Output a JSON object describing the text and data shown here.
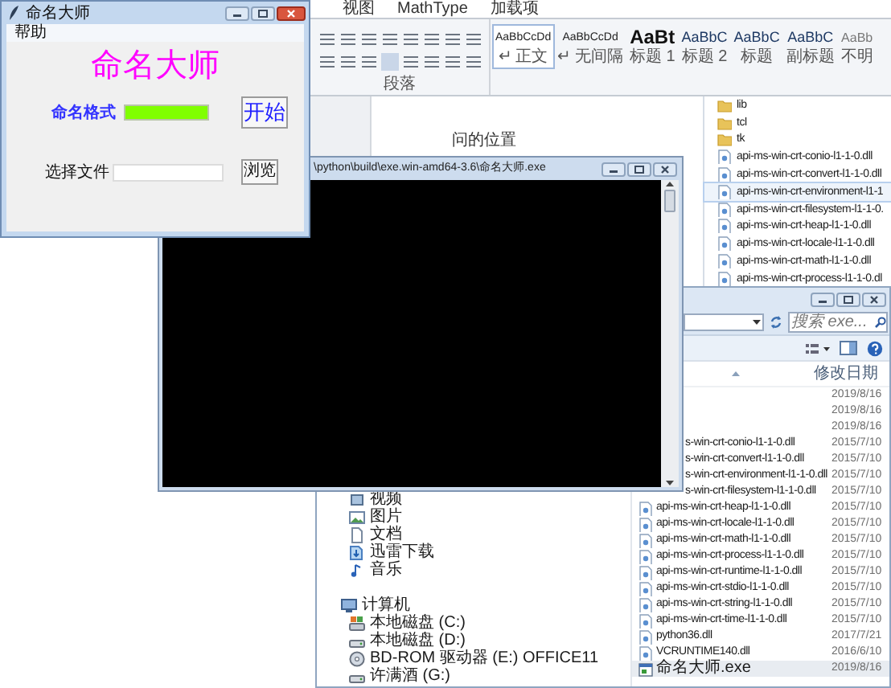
{
  "word": {
    "tabs": [
      "视图",
      "MathType",
      "加载项"
    ],
    "paragraph_group": "段落",
    "styles": [
      {
        "preview": "AaBbCcDd",
        "name": "↵ 正文",
        "kind": "normal",
        "selected": true
      },
      {
        "preview": "AaBbCcDd",
        "name": "↵ 无间隔",
        "kind": "normal",
        "selected": false
      },
      {
        "preview": "AaBt",
        "name": "标题 1",
        "kind": "heading1",
        "selected": false
      },
      {
        "preview": "AaBbC",
        "name": "标题 2",
        "kind": "heading",
        "selected": false
      },
      {
        "preview": "AaBbC",
        "name": "标题",
        "kind": "heading",
        "selected": false
      },
      {
        "preview": "AaBbC",
        "name": "副标题",
        "kind": "heading",
        "selected": false
      },
      {
        "preview": "AaBb",
        "name": "不明",
        "kind": "subtle",
        "selected": false
      }
    ],
    "document_text": "问的位置"
  },
  "explorer_back": {
    "files": [
      {
        "name": "lib",
        "kind": "folder",
        "selected": false
      },
      {
        "name": "tcl",
        "kind": "folder",
        "selected": false
      },
      {
        "name": "tk",
        "kind": "folder",
        "selected": false
      },
      {
        "name": "api-ms-win-crt-conio-l1-1-0.dll",
        "kind": "file",
        "selected": false
      },
      {
        "name": "api-ms-win-crt-convert-l1-1-0.dll",
        "kind": "file",
        "selected": false
      },
      {
        "name": "api-ms-win-crt-environment-l1-1",
        "kind": "file",
        "selected": true
      },
      {
        "name": "api-ms-win-crt-filesystem-l1-1-0.",
        "kind": "file",
        "selected": false
      },
      {
        "name": "api-ms-win-crt-heap-l1-1-0.dll",
        "kind": "file",
        "selected": false
      },
      {
        "name": "api-ms-win-crt-locale-l1-1-0.dll",
        "kind": "file",
        "selected": false
      },
      {
        "name": "api-ms-win-crt-math-l1-1-0.dll",
        "kind": "file",
        "selected": false
      },
      {
        "name": "api-ms-win-crt-process-l1-1-0.dl",
        "kind": "file",
        "selected": false
      }
    ]
  },
  "explorer_front": {
    "search": {
      "placeholder": "搜索 exe..."
    },
    "column_header": "修改日期",
    "libraries": [
      {
        "label": "视频",
        "kind": "video"
      },
      {
        "label": "图片",
        "kind": "picture"
      },
      {
        "label": "文档",
        "kind": "document"
      },
      {
        "label": "迅雷下载",
        "kind": "download"
      },
      {
        "label": "音乐",
        "kind": "music"
      }
    ],
    "computer": {
      "label": "计算机",
      "children": [
        {
          "label": "本地磁盘 (C:)",
          "kind": "system-drive"
        },
        {
          "label": "本地磁盘 (D:)",
          "kind": "drive"
        },
        {
          "label": "BD-ROM 驱动器 (E:) OFFICE11",
          "kind": "optical"
        },
        {
          "label": "许满酒 (G:)",
          "kind": "drive"
        }
      ]
    },
    "files": [
      {
        "date": "2019/8/16",
        "kind": "hidden",
        "selected": false
      },
      {
        "date": "2019/8/16",
        "kind": "hidden",
        "selected": false
      },
      {
        "date": "2019/8/16",
        "kind": "hidden",
        "selected": false
      },
      {
        "name": "s-win-crt-conio-l1-1-0.dll",
        "date": "2015/7/10",
        "kind": "cut",
        "selected": false
      },
      {
        "name": "s-win-crt-convert-l1-1-0.dll",
        "date": "2015/7/10",
        "kind": "cut",
        "selected": false
      },
      {
        "name": "s-win-crt-environment-l1-1-0.dll",
        "date": "2015/7/10",
        "kind": "cut",
        "selected": false
      },
      {
        "name": "s-win-crt-filesystem-l1-1-0.dll",
        "date": "2015/7/10",
        "kind": "cut",
        "selected": false
      },
      {
        "name": "api-ms-win-crt-heap-l1-1-0.dll",
        "date": "2015/7/10",
        "kind": "file",
        "selected": false
      },
      {
        "name": "api-ms-win-crt-locale-l1-1-0.dll",
        "date": "2015/7/10",
        "kind": "file",
        "selected": false
      },
      {
        "name": "api-ms-win-crt-math-l1-1-0.dll",
        "date": "2015/7/10",
        "kind": "file",
        "selected": false
      },
      {
        "name": "api-ms-win-crt-process-l1-1-0.dll",
        "date": "2015/7/10",
        "kind": "file",
        "selected": false
      },
      {
        "name": "api-ms-win-crt-runtime-l1-1-0.dll",
        "date": "2015/7/10",
        "kind": "file",
        "selected": false
      },
      {
        "name": "api-ms-win-crt-stdio-l1-1-0.dll",
        "date": "2015/7/10",
        "kind": "file",
        "selected": false
      },
      {
        "name": "api-ms-win-crt-string-l1-1-0.dll",
        "date": "2015/7/10",
        "kind": "file",
        "selected": false
      },
      {
        "name": "api-ms-win-crt-time-l1-1-0.dll",
        "date": "2015/7/10",
        "kind": "file",
        "selected": false
      },
      {
        "name": "python36.dll",
        "date": "2017/7/21",
        "kind": "file",
        "selected": false
      },
      {
        "name": "VCRUNTIME140.dll",
        "date": "2016/6/10",
        "kind": "file",
        "selected": false
      },
      {
        "name": "命名大师.exe",
        "date": "2019/8/16",
        "kind": "app",
        "selected": true
      }
    ]
  },
  "console": {
    "title": "\\python\\build\\exe.win-amd64-3.6\\命名大师.exe"
  },
  "app": {
    "title": "命名大师",
    "menu": [
      "帮助"
    ],
    "heading": "命名大师",
    "format_label": "命名格式",
    "start_button": "开始",
    "file_label": "选择文件",
    "browse_button": "浏览"
  }
}
